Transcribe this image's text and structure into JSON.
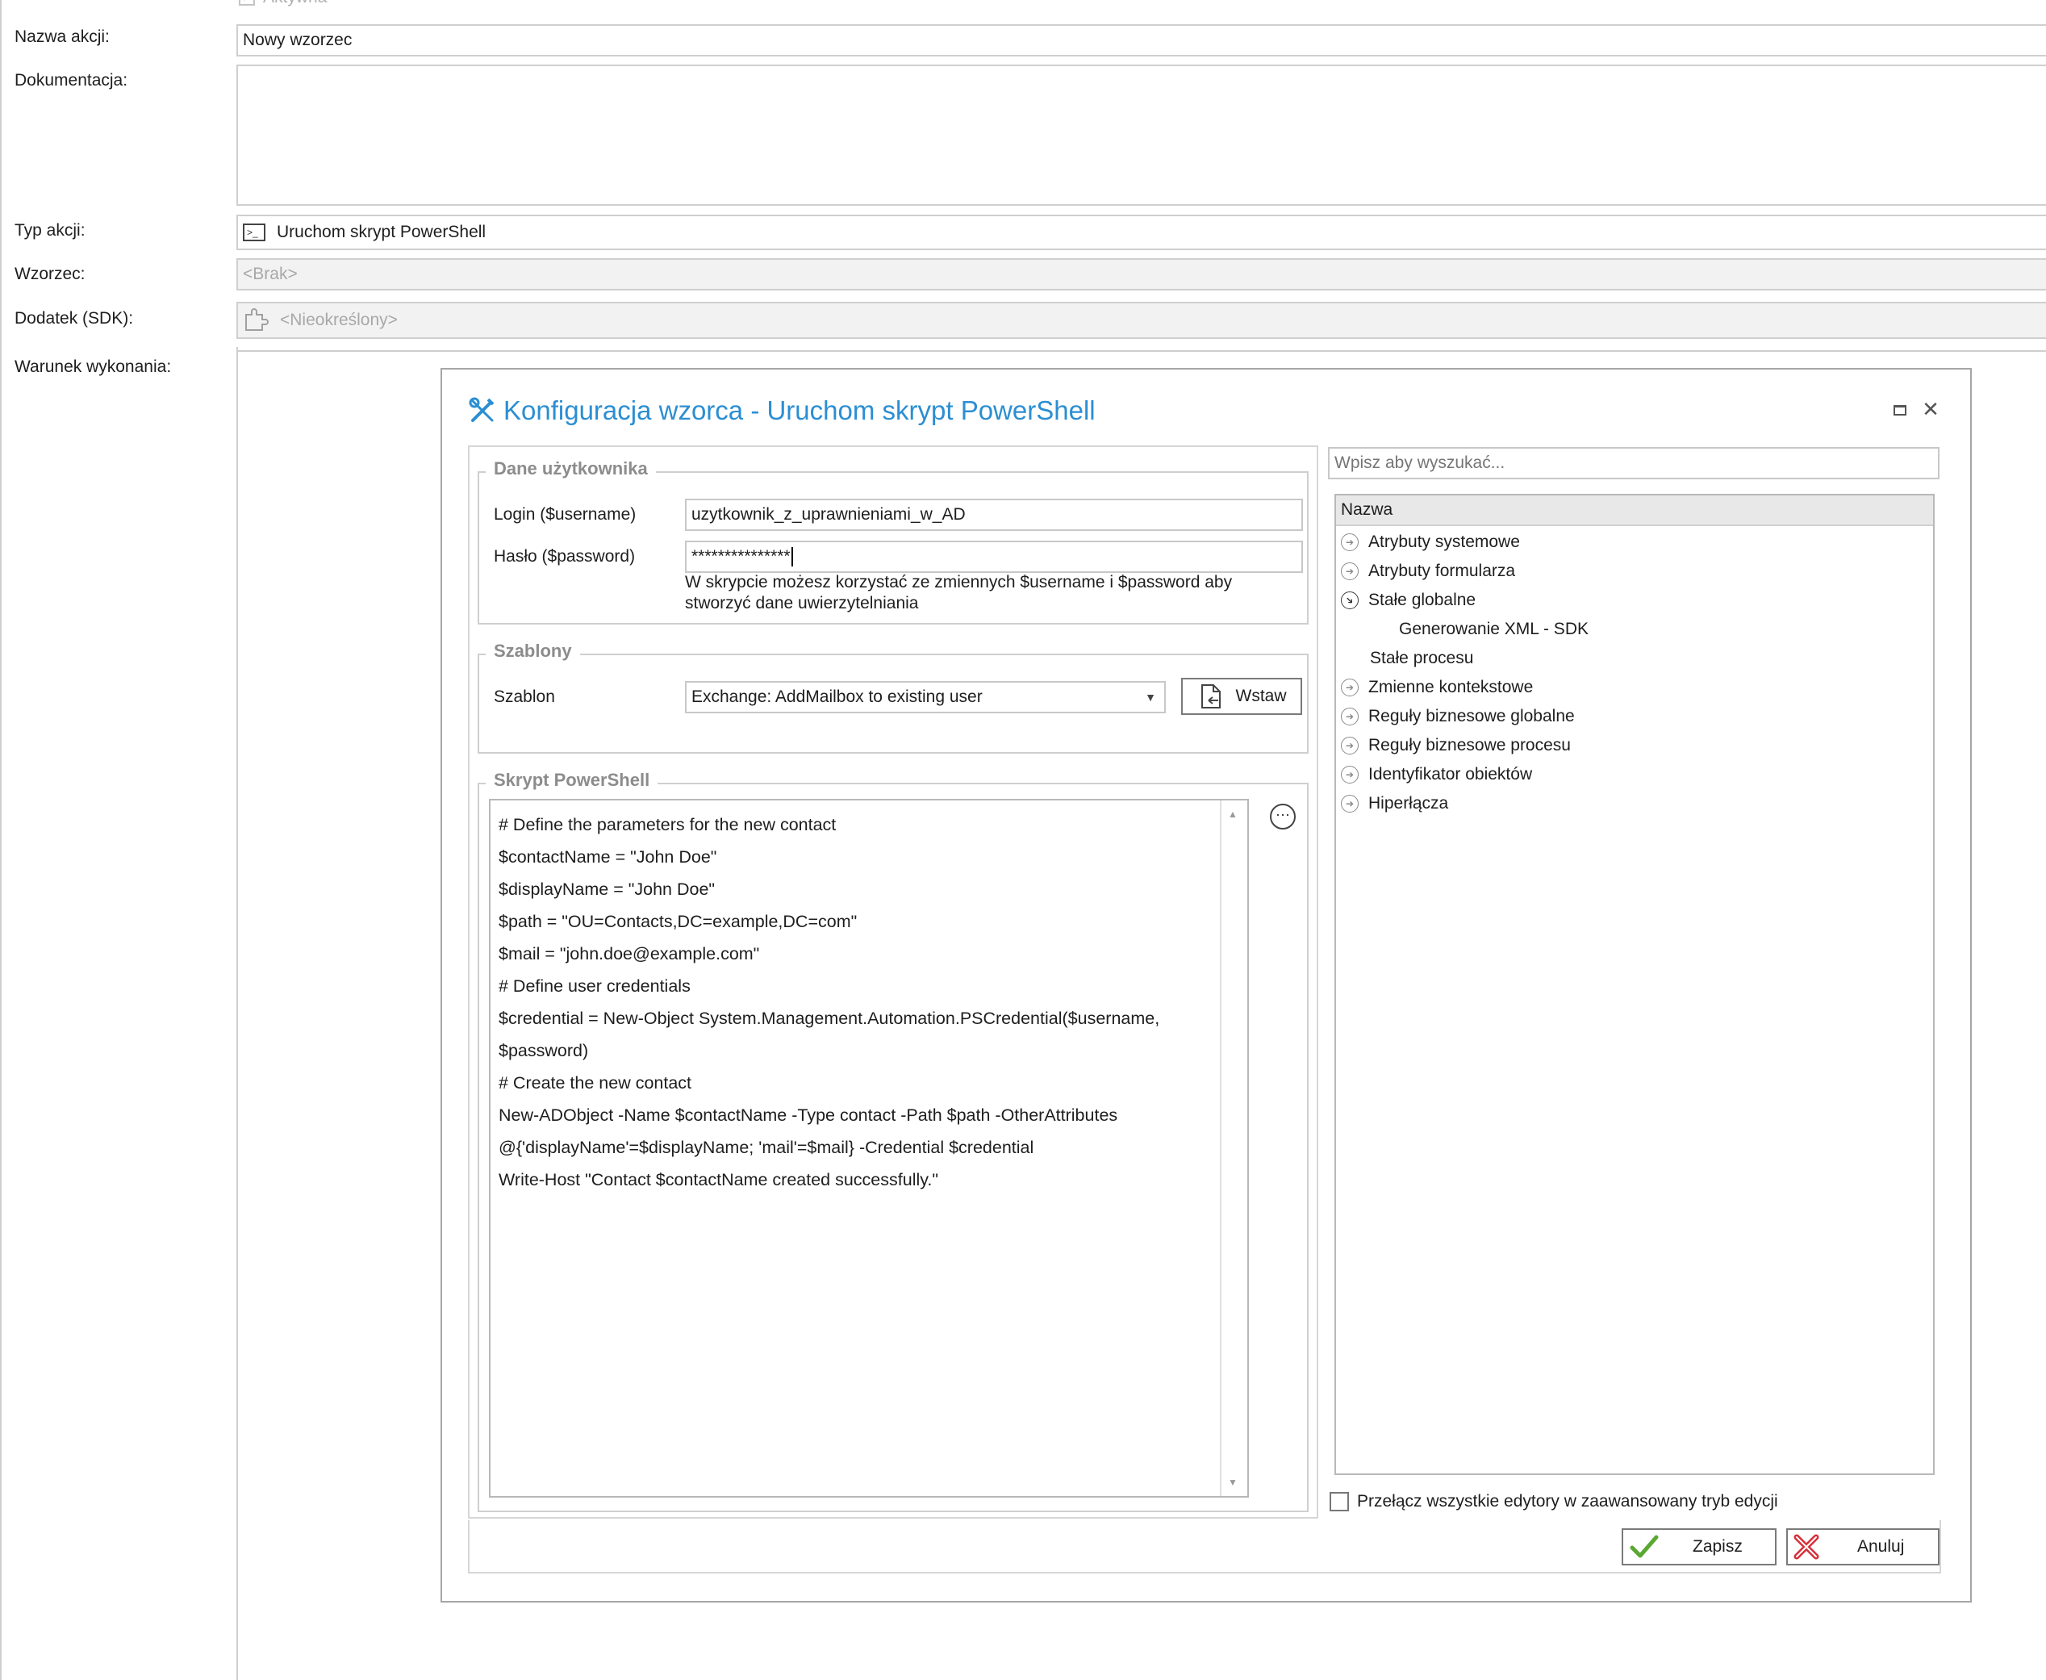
{
  "form": {
    "active_label": "Aktywna",
    "action_name_label": "Nazwa akcji:",
    "action_name_value": "Nowy wzorzec",
    "documentation_label": "Dokumentacja:",
    "action_type_label": "Typ akcji:",
    "action_type_value": "Uruchom skrypt PowerShell",
    "pattern_label": "Wzorzec:",
    "pattern_value": "<Brak>",
    "addon_label": "Dodatek (SDK):",
    "addon_value": "<Nieokreślony>",
    "condition_label": "Warunek wykonania:"
  },
  "dialog": {
    "title": "Konfiguracja wzorca - Uruchom skrypt PowerShell",
    "user_group": {
      "caption": "Dane użytkownika",
      "login_label": "Login ($username)",
      "login_value": "uzytkownik_z_uprawnieniami_w_AD",
      "password_label": "Hasło ($password)",
      "password_value": "***************",
      "hint_line1": "W skrypcie możesz korzystać ze zmiennych $username i $password aby",
      "hint_line2": "stworzyć dane uwierzytelniania"
    },
    "templates_group": {
      "caption": "Szablony",
      "template_label": "Szablon",
      "template_value": "Exchange: AddMailbox to existing user",
      "insert_button": "Wstaw"
    },
    "script_group": {
      "caption": "Skrypt PowerShell",
      "lines": [
        "# Define the parameters for the new contact",
        "$contactName = \"John Doe\"",
        "$displayName = \"John Doe\"",
        "$path = \"OU=Contacts,DC=example,DC=com\"",
        "$mail = \"john.doe@example.com\"",
        "",
        "# Define user credentials",
        "$credential = New-Object System.Management.Automation.PSCredential($username,",
        "$password)",
        "",
        "# Create the new contact",
        "New-ADObject -Name $contactName -Type contact -Path $path -OtherAttributes",
        "@{'displayName'=$displayName; 'mail'=$mail} -Credential $credential",
        "",
        "Write-Host \"Contact $contactName created successfully.\""
      ]
    },
    "search_placeholder": "Wpisz aby wyszukać...",
    "tree": {
      "header": "Nazwa",
      "items": [
        {
          "label": "Atrybuty systemowe",
          "icon": "expand-icon"
        },
        {
          "label": "Atrybuty formularza",
          "icon": "expand-icon"
        },
        {
          "label": "Stałe globalne",
          "icon": "collapse-icon"
        },
        {
          "label": "Generowanie XML -  SDK",
          "icon": "none"
        },
        {
          "label": "Stałe procesu",
          "icon": "none"
        },
        {
          "label": "Zmienne kontekstowe",
          "icon": "expand-icon"
        },
        {
          "label": "Reguły biznesowe globalne",
          "icon": "expand-icon"
        },
        {
          "label": "Reguły biznesowe procesu",
          "icon": "expand-icon"
        },
        {
          "label": "Identyfikator obiektów",
          "icon": "expand-icon"
        },
        {
          "label": "Hiperłącza",
          "icon": "expand-icon"
        }
      ]
    },
    "advanced_toggle_label": "Przełącz wszystkie edytory w zaawansowany tryb edycji",
    "save_button": "Zapisz",
    "cancel_button": "Anuluj"
  },
  "colors": {
    "accent": "#2b8ed3",
    "save_check": "#5aa832",
    "cancel_x": "#d6303a"
  }
}
